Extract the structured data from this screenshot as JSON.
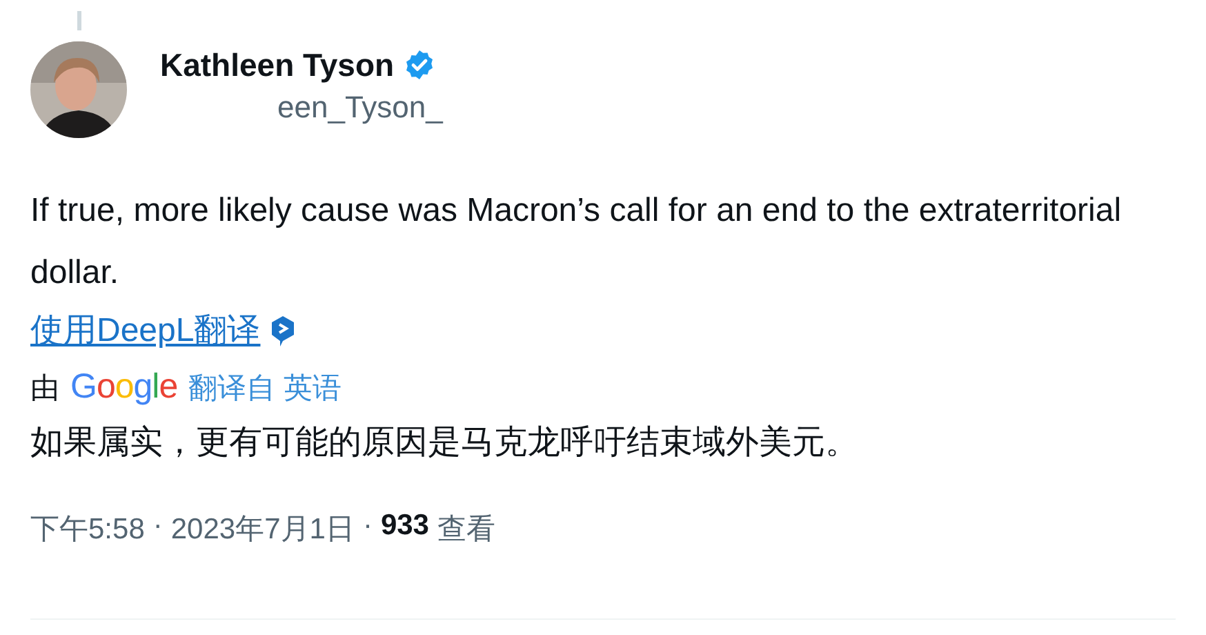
{
  "tweet": {
    "author": {
      "name": "Kathleen Tyson",
      "verified": true,
      "handle": "een_Tyson_"
    },
    "text": "If true, more likely cause was Macron’s call for an end to the extraterritorial dollar.",
    "translate_link": "使用DeepL翻译",
    "translation": {
      "prefix": "由",
      "brand": "Google",
      "source": "翻译自 英语",
      "text": "如果属实，更有可能的原因是马克龙呼吁结束域外美元。"
    },
    "meta": {
      "time": "下午5:58",
      "separator_1": "·",
      "date": "2023年7月1日",
      "separator_2": "·",
      "views": "933",
      "views_label": "查看"
    }
  }
}
